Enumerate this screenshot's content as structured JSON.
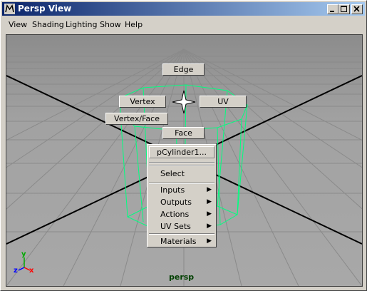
{
  "window": {
    "title": "Persp View"
  },
  "menubar": {
    "items": [
      "View",
      "Shading",
      "Lighting",
      "Show",
      "Help"
    ]
  },
  "marking_menu": {
    "edge": "Edge",
    "vertex": "Vertex",
    "uv": "UV",
    "vertex_face": "Vertex/Face",
    "face": "Face"
  },
  "context_menu": {
    "title": "pCylinder1...",
    "select": "Select",
    "inputs": "Inputs",
    "outputs": "Outputs",
    "actions": "Actions",
    "uv_sets": "UV Sets",
    "materials": "Materials"
  },
  "viewport": {
    "camera_label": "persp",
    "axis": {
      "x": "x",
      "y": "y",
      "z": "z"
    }
  },
  "colors": {
    "grid_bg": "#a0a0a0",
    "wireframe": "#00ff80",
    "camera_label": "#004000"
  }
}
